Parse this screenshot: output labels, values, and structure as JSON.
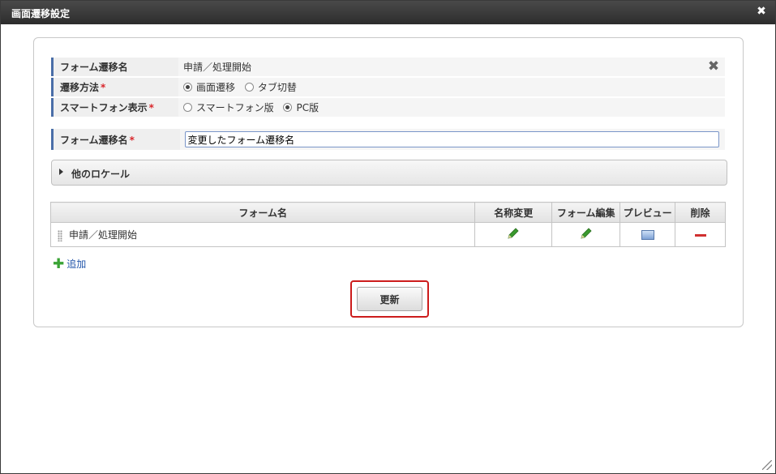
{
  "dialog": {
    "title": "画面遷移設定",
    "close_icon": "close-icon"
  },
  "properties": {
    "transition_name_label": "フォーム遷移名",
    "transition_name_value": "申請／処理開始",
    "method_label": "遷移方法",
    "method_options": [
      {
        "label": "画面遷移",
        "selected": true
      },
      {
        "label": "タブ切替",
        "selected": false
      }
    ],
    "smartphone_label": "スマートフォン表示",
    "smartphone_options": [
      {
        "label": "スマートフォン版",
        "selected": false
      },
      {
        "label": "PC版",
        "selected": true
      }
    ],
    "required_mark": "*"
  },
  "name_field": {
    "label": "フォーム遷移名",
    "value": "変更したフォーム遷移名"
  },
  "locale": {
    "label": "他のロケール"
  },
  "form_table": {
    "headers": [
      "フォーム名",
      "名称変更",
      "フォーム編集",
      "プレビュー",
      "削除"
    ],
    "rows": [
      {
        "name": "申請／処理開始"
      }
    ]
  },
  "add": {
    "label": "追加"
  },
  "update_button": {
    "label": "更新"
  },
  "colors": {
    "accent": "#4a6ea8",
    "highlight": "#cc1c1c",
    "edit_green": "#3a9a2e"
  }
}
